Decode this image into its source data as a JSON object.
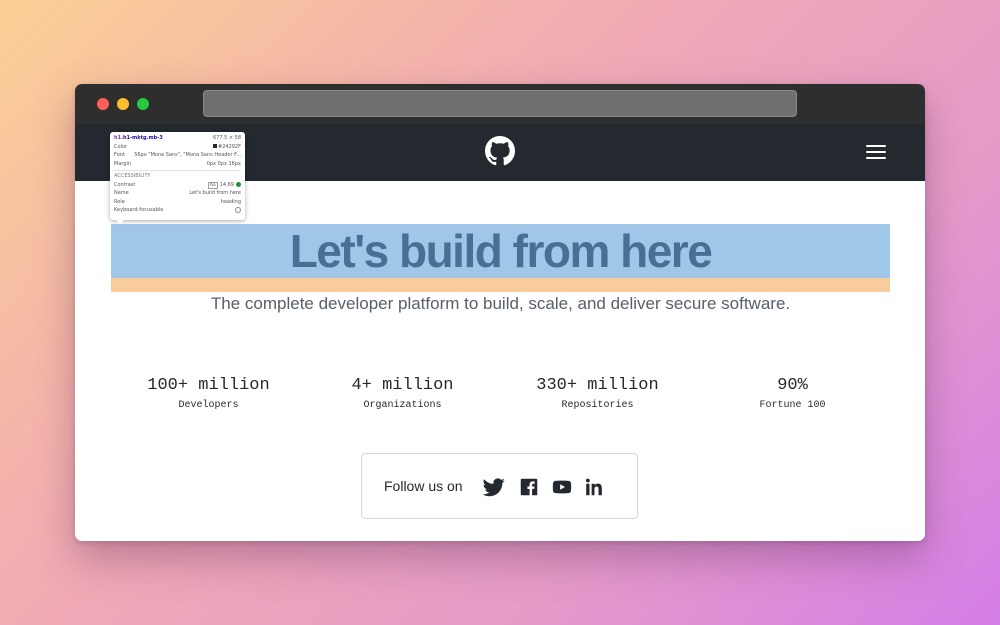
{
  "hero": {
    "title": "Let's build from here",
    "subtitle": "The complete developer platform to build, scale, and deliver secure software."
  },
  "stats": [
    {
      "value": "100+ million",
      "label": "Developers"
    },
    {
      "value": "4+ million",
      "label": "Organizations"
    },
    {
      "value": "330+ million",
      "label": "Repositories"
    },
    {
      "value": "90%",
      "label": "Fortune 100"
    }
  ],
  "follow": {
    "label": "Follow us on",
    "icons": [
      "twitter-icon",
      "facebook-icon",
      "youtube-icon",
      "linkedin-icon"
    ]
  },
  "inspector": {
    "selector_tag": "h1",
    "selector_class": ".h1-mktg.mb-3",
    "size": "677.5 × 58",
    "color_label": "Color",
    "color_value": "#24292F",
    "font_label": "Font",
    "font_value": "56px \"Mona Sans\", \"Mona Sans Header F...",
    "margin_label": "Margin",
    "margin_value": "0px 0px 16px",
    "accessibility_label": "ACCESSIBILITY",
    "contrast_label": "Contrast",
    "contrast_badge": "Aa",
    "contrast_value": "14.69",
    "name_label": "Name",
    "name_value": "Let's build from here",
    "role_label": "Role",
    "role_value": "heading",
    "keyboard_label": "Keyboard-focusable"
  },
  "colors": {
    "navbar": "#24292f",
    "content_highlight": "#6fa8dc",
    "margin_highlight": "#f6b26b",
    "title_text": "#4a6f94"
  }
}
